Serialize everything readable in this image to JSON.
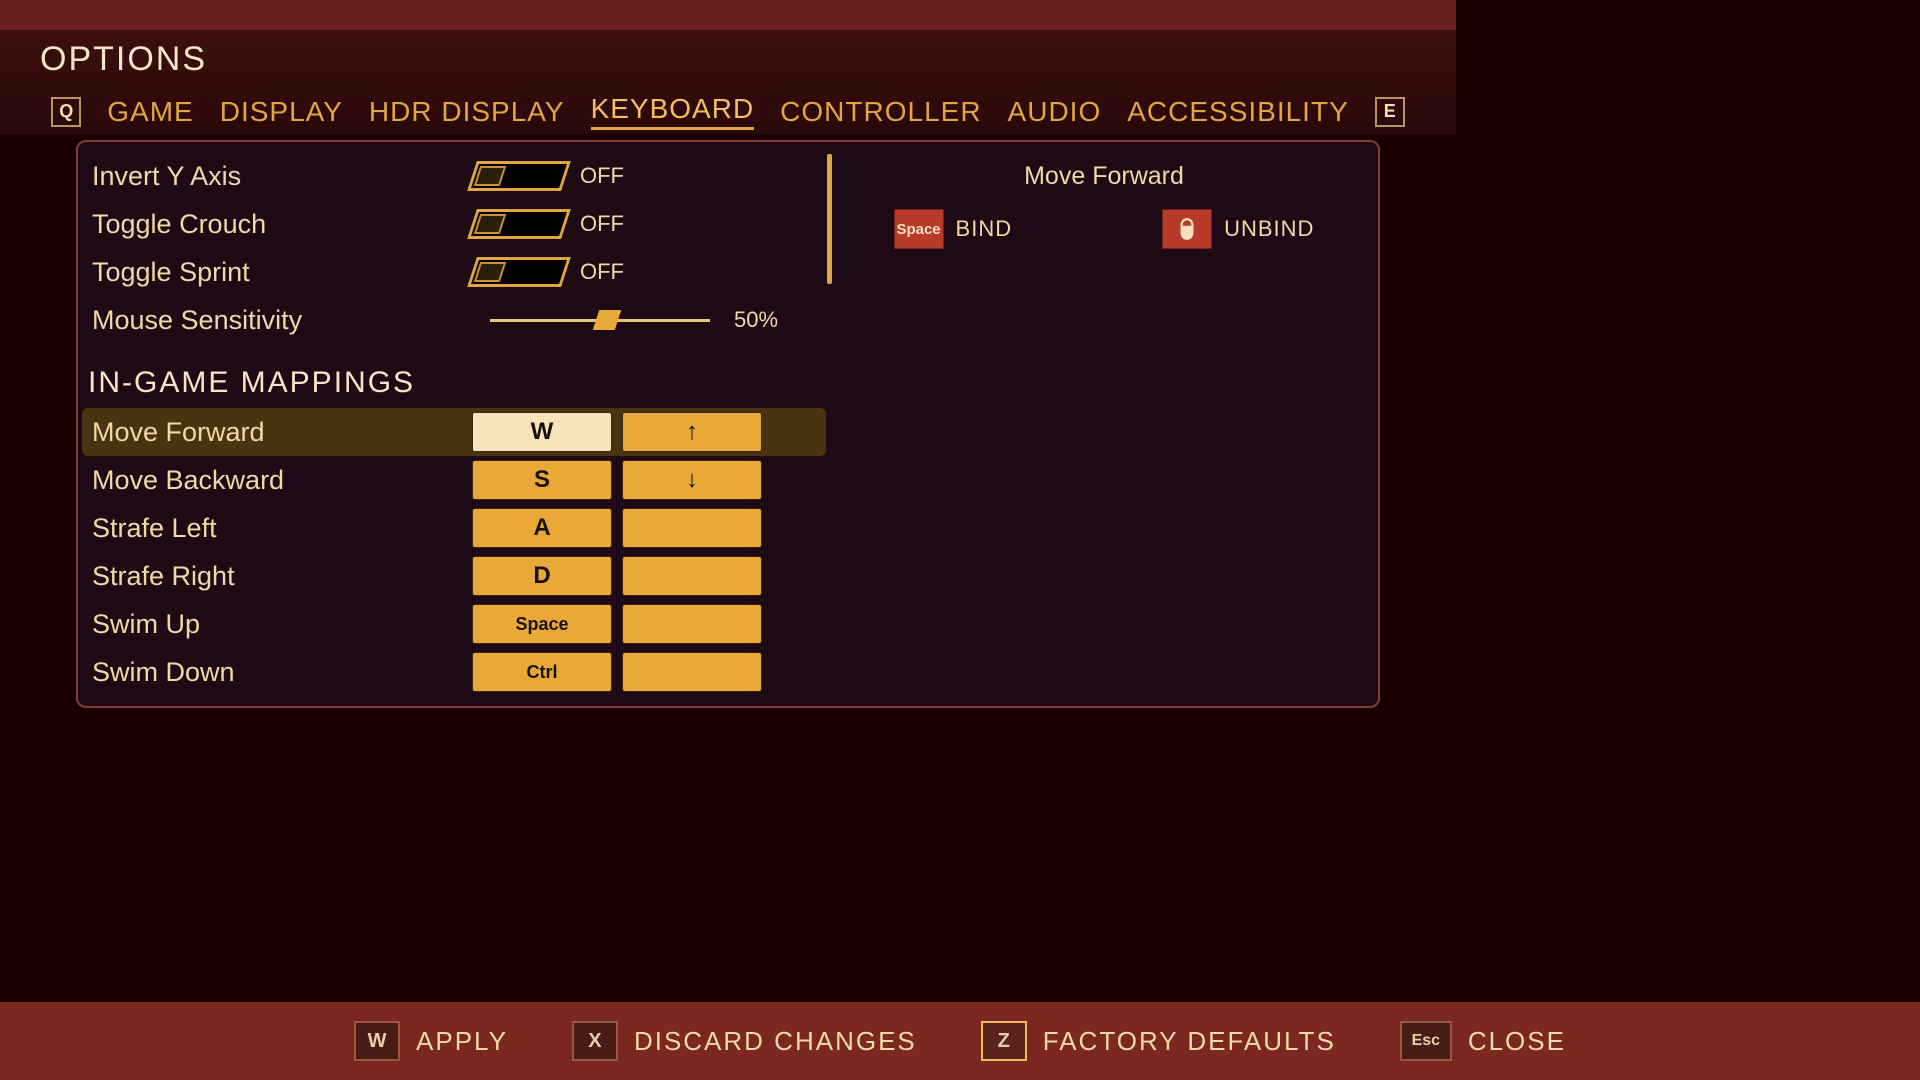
{
  "header": {
    "title": "OPTIONS"
  },
  "tabs": {
    "prev_key": "Q",
    "next_key": "E",
    "items": [
      "GAME",
      "DISPLAY",
      "HDR DISPLAY",
      "KEYBOARD",
      "CONTROLLER",
      "AUDIO",
      "ACCESSIBILITY"
    ],
    "active": 3
  },
  "settings": [
    {
      "label": "Invert Y Axis",
      "value": "OFF"
    },
    {
      "label": "Toggle Crouch",
      "value": "OFF"
    },
    {
      "label": "Toggle Sprint",
      "value": "OFF"
    }
  ],
  "slider": {
    "label": "Mouse Sensitivity",
    "value": "50%"
  },
  "section": "IN-GAME MAPPINGS",
  "mappings": [
    {
      "label": "Move Forward",
      "primary": "W",
      "secondary": "↑",
      "selected": true
    },
    {
      "label": "Move Backward",
      "primary": "S",
      "secondary": "↓"
    },
    {
      "label": "Strafe Left",
      "primary": "A",
      "secondary": ""
    },
    {
      "label": "Strafe Right",
      "primary": "D",
      "secondary": ""
    },
    {
      "label": "Swim Up",
      "primary": "Space",
      "secondary": "",
      "small": true
    },
    {
      "label": "Swim Down",
      "primary": "Ctrl",
      "secondary": "",
      "small": true
    }
  ],
  "detail": {
    "title": "Move Forward",
    "bind_key": "Space",
    "bind_label": "BIND",
    "unbind_label": "UNBIND"
  },
  "footer": [
    {
      "key": "W",
      "label": "APPLY"
    },
    {
      "key": "X",
      "label": "DISCARD CHANGES"
    },
    {
      "key": "Z",
      "label": "FACTORY DEFAULTS",
      "highlighted": true
    },
    {
      "key": "Esc",
      "label": "CLOSE",
      "wide": true
    }
  ]
}
